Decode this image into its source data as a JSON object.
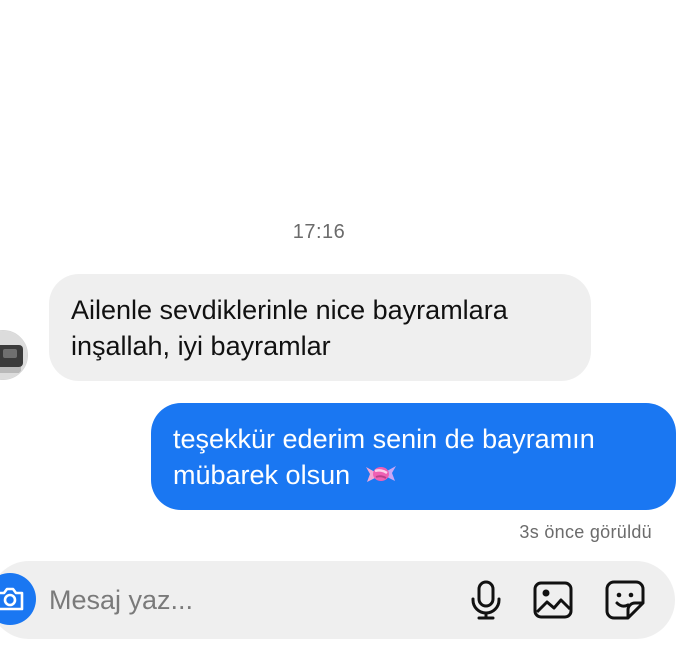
{
  "chat": {
    "timestamp": "17:16",
    "incoming": {
      "line1": "Ailenle sevdiklerinle nice bayramlara",
      "line2": "inşallah, iyi bayramlar"
    },
    "outgoing": {
      "line1": "teşekkür ederim senin de bayramın",
      "line2": "mübarek olsun",
      "emoji": "candy-icon"
    },
    "seen_status": "3s önce görüldü"
  },
  "composer": {
    "placeholder": "Mesaj yaz...",
    "value": "",
    "icons": [
      "camera-icon",
      "microphone-icon",
      "gallery-icon",
      "sticker-icon"
    ]
  },
  "colors": {
    "outgoing_bubble": "#1a77f2",
    "incoming_bubble": "#efefef",
    "composer_bg": "#efefef",
    "meta_text": "#6b6b6b"
  }
}
